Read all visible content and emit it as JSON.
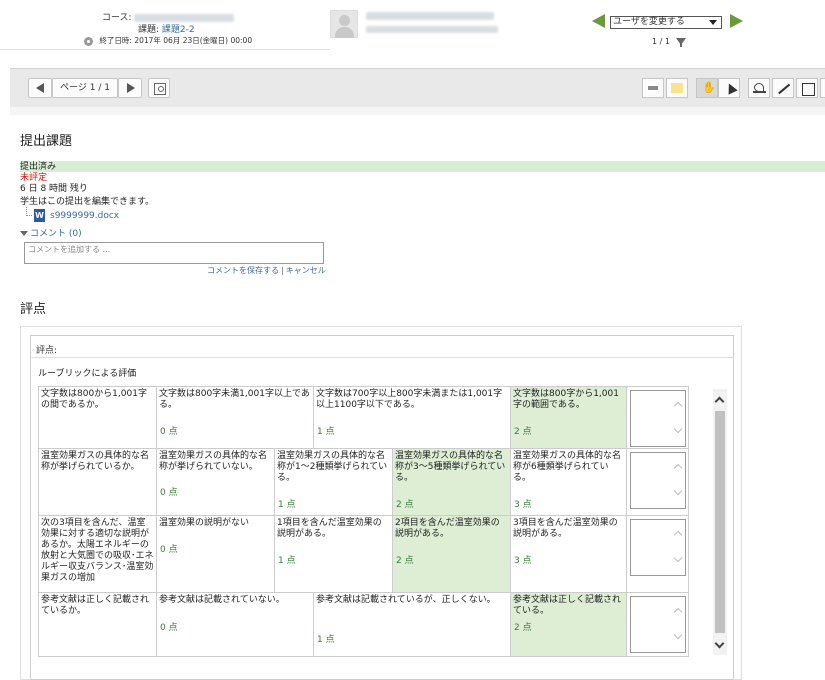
{
  "header": {
    "course_label": "コース:",
    "assignment_label": "課題:",
    "assignment_name": "課題2-2",
    "due_label": "終了日時:",
    "due_value": "2017年 06月 23日(金曜日) 00:00",
    "user_select": {
      "selected": "ユーザを変更する"
    },
    "pager": "1 / 1"
  },
  "toolbar": {
    "page_label": "ページ 1 / 1"
  },
  "submission": {
    "title": "提出課題",
    "status": "提出済み",
    "grading_status": "未評定",
    "time_remaining": "6 日 8 時間 残り",
    "edit_note": "学生はこの提出を編集できます。",
    "file_name": "s9999999.docx",
    "comments_toggle": "コメント (0)",
    "comment_placeholder": "コメントを追加する ...",
    "save_comment": "コメントを保存する",
    "cancel": "キャンセル",
    "separator": "|"
  },
  "grade": {
    "title": "評点",
    "label": "評点:",
    "rubric_label": "ルーブリックによる評価",
    "criteria": [
      {
        "description": "文字数は800から1,001字の間であるか。",
        "levels": [
          {
            "definition": "文字数は800字未満1,001字以上である。",
            "score": "0 点",
            "selected": false
          },
          {
            "definition": "文字数は700字以上800字未満または1,001字以上1100字以下である。",
            "score": "1 点",
            "selected": false
          },
          {
            "definition": "文字数は800字から1,001字の範囲である。",
            "score": "2 点",
            "selected": true
          }
        ]
      },
      {
        "description": "温室効果ガスの具体的な名称が挙げられているか。",
        "levels": [
          {
            "definition": "温室効果ガスの具体的な名称が挙げられていない。",
            "score": "0 点",
            "selected": false
          },
          {
            "definition": "温室効果ガスの具体的な名称が1～2種類挙げられている。",
            "score": "1 点",
            "selected": false
          },
          {
            "definition": "温室効果ガスの具体的な名称が3～5種類挙げられている。",
            "score": "2 点",
            "selected": true
          },
          {
            "definition": "温室効果ガスの具体的な名称が6種類挙げられている。",
            "score": "3 点",
            "selected": false
          }
        ]
      },
      {
        "description": "次の3項目を含んだ、温室効果に対する適切な説明があるか。太陽エネルギーの放射と大気圏での吸収･エネルギー収支バランス･温室効果ガスの増加",
        "levels": [
          {
            "definition": "温室効果の説明がない",
            "score": "0 点",
            "selected": false
          },
          {
            "definition": "1項目を含んだ温室効果の説明がある。",
            "score": "1 点",
            "selected": false
          },
          {
            "definition": "2項目を含んだ温室効果の説明がある。",
            "score": "2 点",
            "selected": true
          },
          {
            "definition": "3項目を含んだ温室効果の説明がある。",
            "score": "3 点",
            "selected": false
          }
        ]
      },
      {
        "description": "参考文献は正しく記載されているか。",
        "levels": [
          {
            "definition": "参考文献は記載されていない。",
            "score": "0 点",
            "selected": false
          },
          {
            "definition": "参考文献は記載されているが、正しくない。",
            "score": "1 点",
            "selected": false
          },
          {
            "definition": "参考文献は正しく記載されている。",
            "score": "2 点",
            "selected": true
          }
        ]
      }
    ]
  }
}
